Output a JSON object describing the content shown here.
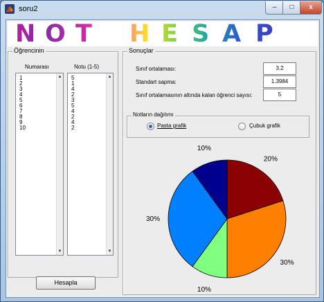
{
  "window": {
    "title": "soru2",
    "controls": {
      "minimize": "–",
      "maximize": "□",
      "close": "x"
    }
  },
  "banner": {
    "letters": [
      "N",
      "O",
      "T",
      "H",
      "E",
      "S",
      "A",
      "P"
    ]
  },
  "students": {
    "title": "Öğrencinin",
    "col1_header": "Numarası",
    "col2_header": "Notu (1-5)",
    "numbers": [
      "1",
      "2",
      "3",
      "4",
      "5",
      "6",
      "7",
      "8",
      "9",
      "10"
    ],
    "grades": [
      "5",
      "1",
      "4",
      "2",
      "3",
      "5",
      "4",
      "2",
      "4",
      "2"
    ],
    "scroll_up": "▲",
    "scroll_down": "▼"
  },
  "results": {
    "title": "Sonuçlar",
    "average_label": "Sınıf ortalaması:",
    "average_value": "3.2",
    "stddev_label": "Standart sapma:",
    "stddev_value": "1.3984",
    "below_label": "Sınıf ortalamasının altında kalan öğrenci sayısı:",
    "below_value": "5"
  },
  "distribution": {
    "title": "Notların dağılımı",
    "pie_option": "Pasta grafik",
    "bar_option": "Çubuk grafik",
    "selected": "pie"
  },
  "compute_button": "Hesapla",
  "chart_data": {
    "type": "pie",
    "slices": [
      {
        "label": "20%",
        "value": 20,
        "color": "#8b0000"
      },
      {
        "label": "30%",
        "value": 30,
        "color": "#ff8000"
      },
      {
        "label": "10%",
        "value": 10,
        "color": "#80ff80"
      },
      {
        "label": "30%",
        "value": 30,
        "color": "#0080ff"
      },
      {
        "label": "10%",
        "value": 10,
        "color": "#00008f"
      }
    ]
  }
}
